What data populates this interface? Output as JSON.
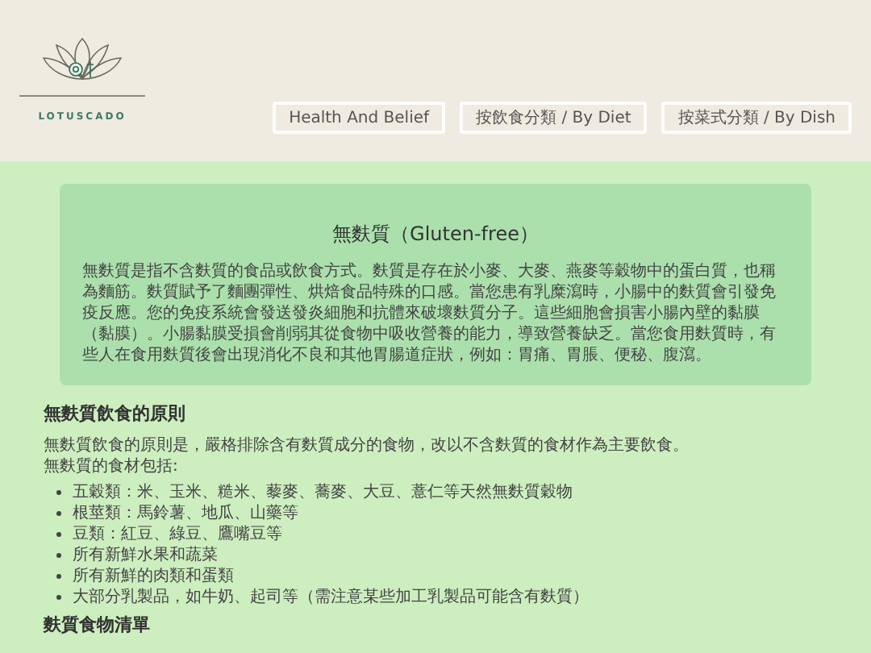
{
  "header": {
    "logo_text": "LOTUSCADO",
    "nav": [
      {
        "label": "Health And Belief"
      },
      {
        "label": "按飲食分類 / By Diet"
      },
      {
        "label": "按菜式分類 / By Dish"
      }
    ]
  },
  "intro_card": {
    "title": "無麩質（Gluten-free）",
    "text": "無麩質是指不含麩質的食品或飲食方式。麩質是存在於小麥、大麥、燕麥等穀物中的蛋白質，也稱為麵筋。麩質賦予了麵團彈性、烘焙食品特殊的口感。當您患有乳糜瀉時，小腸中的麩質會引發免疫反應。您的免疫系統會發送發炎細胞和抗體來破壞麩質分子。這些細胞會損害小腸內壁的黏膜（黏膜）。小腸黏膜受損會削弱其從食物中吸收營養的能力，導致營養缺乏。當您食用麩質時，有些人在食用麩質後會出現消化不良和其他胃腸道症狀，例如：胃痛、胃脹、便秘、腹瀉。"
  },
  "principles": {
    "heading": "無麩質飲食的原則",
    "lines": [
      "無麩質飲食的原則是，嚴格排除含有麩質成分的食物，改以不含麩質的食材作為主要飲食。",
      "無麩質的食材包括:"
    ],
    "items": [
      "五穀類：米、玉米、糙米、藜麥、蕎麥、大豆、薏仁等天然無麩質穀物",
      "根莖類：馬鈴薯、地瓜、山藥等",
      "豆類：紅豆、綠豆、鷹嘴豆等",
      "所有新鮮水果和蔬菜",
      "所有新鮮的肉類和蛋類",
      "大部分乳製品，如牛奶、起司等（需注意某些加工乳製品可能含有麩質）"
    ]
  },
  "next_heading": "麩質食物清單"
}
